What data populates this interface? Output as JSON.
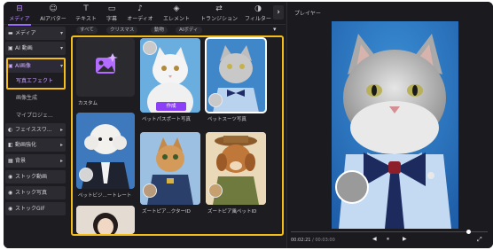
{
  "toolbar": {
    "tabs": [
      {
        "label": "メディア",
        "icon": "media-icon",
        "glyph": "⊟"
      },
      {
        "label": "AIアバター",
        "icon": "avatar-icon",
        "glyph": "☺"
      },
      {
        "label": "テキスト",
        "icon": "text-icon",
        "glyph": "T"
      },
      {
        "label": "字幕",
        "icon": "subtitle-icon",
        "glyph": "▭"
      },
      {
        "label": "オーディオ",
        "icon": "audio-icon",
        "glyph": "♪"
      },
      {
        "label": "エレメント",
        "icon": "element-icon",
        "glyph": "◈"
      },
      {
        "label": "トランジション",
        "icon": "transition-icon",
        "glyph": "⇄"
      },
      {
        "label": "フィルター",
        "icon": "filter-icon",
        "glyph": "◑"
      }
    ],
    "next_glyph": "›"
  },
  "sidebar": {
    "items": [
      {
        "label": "メディア",
        "icon": "folder-icon",
        "glyph": "▬",
        "chevron": "▾"
      },
      {
        "label": "AI 動画",
        "icon": "ai-video-icon",
        "glyph": "▣",
        "chevron": "▾"
      },
      {
        "label": "AI画像",
        "icon": "ai-image-icon",
        "glyph": "▣",
        "chevron": "▾"
      },
      {
        "label": "フェイススワ...",
        "icon": "face-swap-icon",
        "glyph": "◐",
        "chevron": "▸"
      },
      {
        "label": "動画強化",
        "icon": "enhance-icon",
        "glyph": "◧",
        "chevron": "▸"
      },
      {
        "label": "背景",
        "icon": "background-icon",
        "glyph": "▦",
        "chevron": "▸"
      },
      {
        "label": "ストック動画",
        "icon": "stock-video-icon",
        "glyph": "◉",
        "chevron": ""
      },
      {
        "label": "ストック写真",
        "icon": "stock-photo-icon",
        "glyph": "◉",
        "chevron": ""
      },
      {
        "label": "ストックGIF",
        "icon": "stock-gif-icon",
        "glyph": "◉",
        "chevron": ""
      }
    ],
    "subitems": [
      {
        "label": "写真エフェクト"
      },
      {
        "label": "画像生成"
      },
      {
        "label": "マイプロジェ..."
      }
    ]
  },
  "filters": {
    "chips": [
      "すべて",
      "クリスマス",
      "動物",
      "AIボディ"
    ],
    "next_glyph": "▾"
  },
  "cards": [
    {
      "caption": "カスタム",
      "icon": "custom-image-icon"
    },
    {
      "caption": "ペットパスポート写真",
      "button": "作成"
    },
    {
      "caption": "ペットスーツ写真"
    },
    {
      "caption": "ペットビジ...ートレート"
    },
    {
      "caption": "ズートピア...クターID"
    },
    {
      "caption": "ズートピア風ペットID"
    },
    {
      "caption": ""
    }
  ],
  "player": {
    "title": "プレイヤー",
    "time_current": "00:02:21",
    "time_total": "/ 00:03:00",
    "progress": 0.9,
    "controls": {
      "prev": "◀",
      "play": "⏸",
      "next": "▶"
    },
    "fullscreen_glyph": "⤢"
  }
}
